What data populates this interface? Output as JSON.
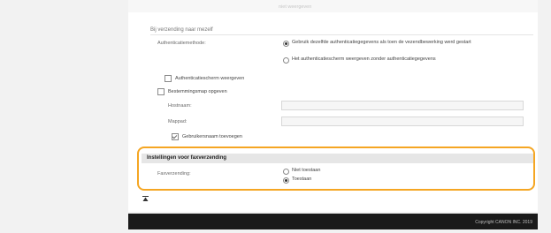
{
  "top": {
    "partial_text": "niet weergeven"
  },
  "sending": {
    "title": "Bij verzending naar mezelf",
    "auth_method_label": "Authenticatiemethode:",
    "auth_option_1": "Gebruik dezelfde authenticatiegegevens als toen de vezendbewerking werd gestart",
    "auth_option_2": "Het authenticatiescherm weergeven zonder authenticatiegegevens",
    "show_auth_screen": "Authenticatiescherm weergeven",
    "dest_folder": "Bestemmingsmap opgeven",
    "hostname_label": "Hostnaam:",
    "folder_label": "Mappad:",
    "add_username": "Gebruikersnaam toevoegen"
  },
  "fax": {
    "title": "Instellingen voor faxverzending",
    "label": "Faxverzending:",
    "option_deny": "Niet toestaan",
    "option_allow": "Toestaan",
    "selected": "Toestaan"
  },
  "footer": {
    "copyright": "Copyright CANON INC. 2019"
  },
  "icons": [
    "scroll-top-icon",
    "radio-selected",
    "radio-unselected",
    "checkbox-checked",
    "checkbox-unchecked"
  ],
  "colors": {
    "highlight": "#f5a623",
    "footer": "#1a1a1a",
    "section_header": "#e6e6e6"
  }
}
